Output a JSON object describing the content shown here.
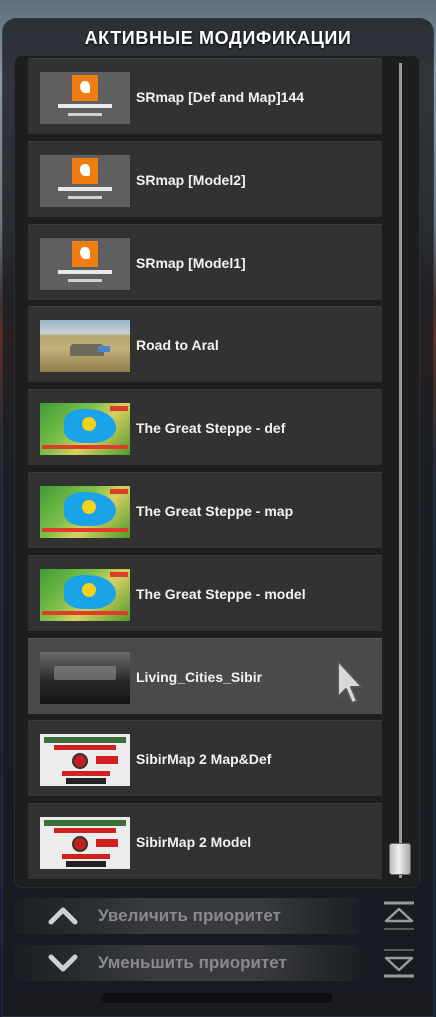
{
  "header": {
    "title": "АКТИВНЫЕ МОДИФИКАЦИИ"
  },
  "mods": [
    {
      "name": "SRmap [Def and Map]144",
      "thumb": "srmap-logo",
      "selected": false
    },
    {
      "name": "SRmap [Model2]",
      "thumb": "srmap-logo",
      "selected": false
    },
    {
      "name": "SRmap [Model1]",
      "thumb": "srmap-logo",
      "selected": false
    },
    {
      "name": "Road to Aral",
      "thumb": "aral-landscape",
      "selected": false
    },
    {
      "name": "The Great Steppe - def",
      "thumb": "kazakhstan-flag-map",
      "selected": false
    },
    {
      "name": "The Great Steppe - map",
      "thumb": "kazakhstan-flag-map",
      "selected": false
    },
    {
      "name": "The Great Steppe - model",
      "thumb": "kazakhstan-flag-map",
      "selected": false
    },
    {
      "name": "Living_Cities_Sibir",
      "thumb": "euro-truck-logo",
      "selected": true
    },
    {
      "name": "SibirMap 2 Map&Def",
      "thumb": "sibirmap-poster",
      "selected": false
    },
    {
      "name": "SibirMap 2 Model",
      "thumb": "sibirmap-poster",
      "selected": false
    }
  ],
  "controls": {
    "increase_priority": "Увеличить приоритет",
    "decrease_priority": "Уменьшить приоритет"
  },
  "scroll": {
    "position_fraction": 1.0
  },
  "colors": {
    "accent": "#ffffff",
    "disabled_text": "#8a8a8a",
    "row_bg": "#323232",
    "row_selected_bg": "#4a4a4a"
  }
}
